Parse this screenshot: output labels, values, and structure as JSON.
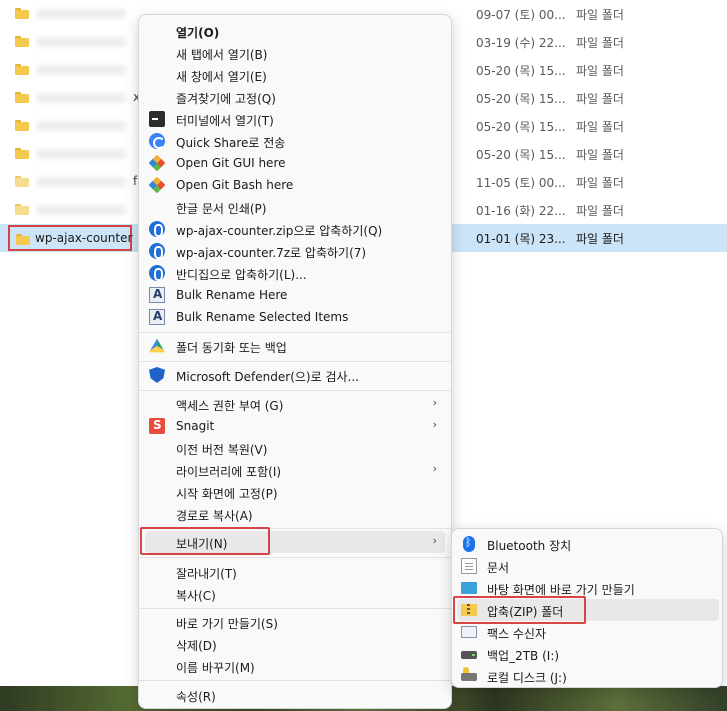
{
  "explorer": {
    "rows": [
      {
        "date": "09-07 (토) 00...",
        "type": "파일 폴더"
      },
      {
        "date": "03-19 (수) 22...",
        "type": "파일 폴더"
      },
      {
        "date": "05-20 (목) 15...",
        "type": "파일 폴더"
      },
      {
        "date": "05-20 (목) 15...",
        "type": "파일 폴더"
      },
      {
        "date": "05-20 (목) 15...",
        "type": "파일 폴더"
      },
      {
        "date": "05-20 (목) 15...",
        "type": "파일 폴더"
      },
      {
        "date": "11-05 (토) 00...",
        "type": "파일 폴더"
      },
      {
        "date": "01-16 (화) 22...",
        "type": "파일 폴더"
      },
      {
        "date": "01-01 (목) 23...",
        "type": "파일 폴더"
      }
    ],
    "selected_name": "wp-ajax-counter",
    "trunc_x": "x",
    "trunc_f": "f"
  },
  "context_menu": {
    "items": [
      {
        "label": "열기(O)",
        "icon": "none"
      },
      {
        "label": "새 탭에서 열기(B)",
        "icon": "none"
      },
      {
        "label": "새 창에서 열기(E)",
        "icon": "none"
      },
      {
        "label": "즐겨찾기에 고정(Q)",
        "icon": "none"
      },
      {
        "label": "터미널에서 열기(T)",
        "icon": "terminal-icon"
      },
      {
        "label": "Quick Share로 전송",
        "icon": "quick-share-icon"
      },
      {
        "label": "Open Git GUI here",
        "icon": "git-icon"
      },
      {
        "label": "Open Git Bash here",
        "icon": "git-icon"
      },
      {
        "label": "한글 문서 인쇄(P)",
        "icon": "none"
      },
      {
        "label": "wp-ajax-counter.zip으로 압축하기(Q)",
        "icon": "bandizip-icon"
      },
      {
        "label": "wp-ajax-counter.7z로 압축하기(7)",
        "icon": "bandizip-icon"
      },
      {
        "label": "반디집으로 압축하기(L)...",
        "icon": "bandizip-icon"
      },
      {
        "label": "Bulk Rename Here",
        "icon": "bulk-rename-icon"
      },
      {
        "label": "Bulk Rename Selected Items",
        "icon": "bulk-rename-icon"
      },
      {
        "label": "폴더 동기화 또는 백업",
        "icon": "google-drive-icon"
      },
      {
        "label": "Microsoft Defender(으)로 검사...",
        "icon": "defender-icon"
      },
      {
        "label": "액세스 권한 부여 (G)",
        "icon": "none"
      },
      {
        "label": "Snagit",
        "icon": "snagit-icon"
      },
      {
        "label": "이전 버전 복원(V)",
        "icon": "none"
      },
      {
        "label": "라이브러리에 포함(I)",
        "icon": "none"
      },
      {
        "label": "시작 화면에 고정(P)",
        "icon": "none"
      },
      {
        "label": "경로로 복사(A)",
        "icon": "none"
      },
      {
        "label": "보내기(N)",
        "icon": "none"
      },
      {
        "label": "잘라내기(T)",
        "icon": "none"
      },
      {
        "label": "복사(C)",
        "icon": "none"
      },
      {
        "label": "바로 가기 만들기(S)",
        "icon": "none"
      },
      {
        "label": "삭제(D)",
        "icon": "none"
      },
      {
        "label": "이름 바꾸기(M)",
        "icon": "none"
      },
      {
        "label": "속성(R)",
        "icon": "none"
      }
    ],
    "submenu_arrow": "›"
  },
  "send_to_menu": {
    "items": [
      {
        "label": "Bluetooth 장치",
        "icon": "bluetooth-icon"
      },
      {
        "label": "문서",
        "icon": "documents-icon"
      },
      {
        "label": "바탕 화면에 바로 가기 만들기",
        "icon": "desktop-icon"
      },
      {
        "label": "압축(ZIP) 폴더",
        "icon": "zip-folder-icon"
      },
      {
        "label": "팩스 수신자",
        "icon": "fax-icon"
      },
      {
        "label": "백업_2TB (I:)",
        "icon": "drive-icon"
      },
      {
        "label": "로컬 디스크 (J:)",
        "icon": "local-disk-icon"
      }
    ]
  },
  "colors": {
    "highlight_box": "#d64545",
    "selection": "#cce4f7",
    "folder": "#f4c94d"
  }
}
